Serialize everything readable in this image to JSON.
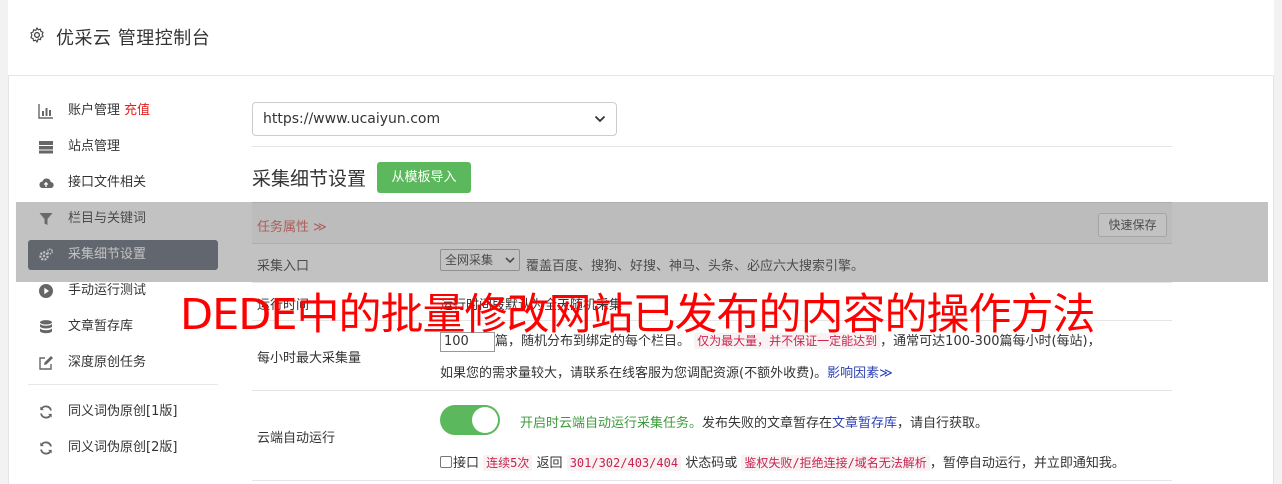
{
  "header": {
    "title": "优采云 管理控制台"
  },
  "sidebar": {
    "items": [
      {
        "label": "账户管理",
        "extra": "充值",
        "icon": "bar-chart-icon"
      },
      {
        "label": "站点管理",
        "icon": "server-icon"
      },
      {
        "label": "接口文件相关",
        "icon": "cloud-upload-icon"
      },
      {
        "label": "栏目与关键词",
        "icon": "filter-icon"
      },
      {
        "label": "采集细节设置",
        "icon": "gears-icon",
        "active": true
      },
      {
        "label": "手动运行测试",
        "icon": "play-circle-icon"
      },
      {
        "label": "文章暂存库",
        "icon": "database-icon"
      },
      {
        "label": "深度原创任务",
        "icon": "edit-icon"
      },
      {
        "label": "同义词伪原创[1版]",
        "icon": "refresh-icon"
      },
      {
        "label": "同义词伪原创[2版]",
        "icon": "refresh-icon"
      }
    ]
  },
  "main": {
    "site_select": "https://www.ucaiyun.com",
    "section_title": "采集细节设置",
    "import_button": "从模板导入",
    "task_attr": "任务属性 ≫",
    "quick_save": "快速保存",
    "row1": {
      "label": "采集入口",
      "select": "全网采集",
      "desc": "覆盖百度、搜狗、好搜、神马、头条、必应六大搜索引擎。"
    },
    "row2": {
      "label": "运行时间",
      "desc": "运行时间段默认为全天随机采集"
    },
    "row3": {
      "label": "每小时最大采集量",
      "value": "100",
      "text1": "篇，随机分布到绑定的每个栏目。",
      "code": "仅为最大量，并不保证一定能达到",
      "text2": "，通常可达100-300篇每小时(每站)，",
      "line2": "如果您的需求量较大，请联系在线客服为您调配资源(不额外收费)。",
      "link": "影响因素≫"
    },
    "row4": {
      "label": "云端自动运行",
      "green_text": "开启时云端自动运行采集任务。",
      "text1": "发布失败的文章暂存在",
      "link": "文章暂存库",
      "text2": "，请自行获取。",
      "chk_label": "接口",
      "code1": "连续5次",
      "text3": "返回",
      "code2": "301/302/403/404",
      "text4": "状态码或",
      "code3": "鉴权失败/拒绝连接/域名无法解析",
      "text5": "，暂停自动运行，并立即通知我。"
    }
  },
  "watermark": "DEDE中的批量修改网站已发布的内容的操作方法",
  "colors": {
    "accent_green": "#5cb85c",
    "active_nav": "#5b6270",
    "watermark": "#ff0000",
    "danger": "#d9534f"
  }
}
